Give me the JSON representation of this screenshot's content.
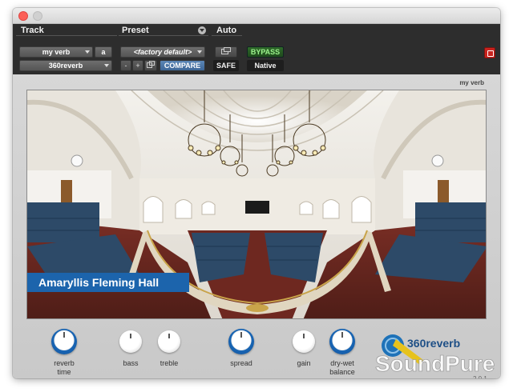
{
  "header": {
    "track_label": "Track",
    "preset_label": "Preset",
    "auto_label": "Auto",
    "track_name": "my verb",
    "track_channel": "a",
    "insert_name": "360reverb",
    "preset_name": "<factory default>",
    "minus_label": "-",
    "plus_label": "+",
    "compare_label": "COMPARE",
    "safe_label": "SAFE",
    "bypass_label": "BYPASS",
    "native_label": "Native"
  },
  "plugin": {
    "instance_name": "my verb",
    "hall_name": "Amaryllis Fleming Hall",
    "knobs": [
      {
        "label": "reverb\ntime"
      },
      {
        "label": "bass"
      },
      {
        "label": "treble"
      },
      {
        "label": "spread"
      },
      {
        "label": "gain"
      },
      {
        "label": "dry-wet\nbalance"
      }
    ],
    "logo": {
      "product": "360reverb",
      "brand": "SoundPure",
      "version": "2.0.1"
    }
  },
  "colors": {
    "accent": "#1966b5",
    "bypass_text": "#9cf28d",
    "header_bg": "#2d2d2d"
  }
}
